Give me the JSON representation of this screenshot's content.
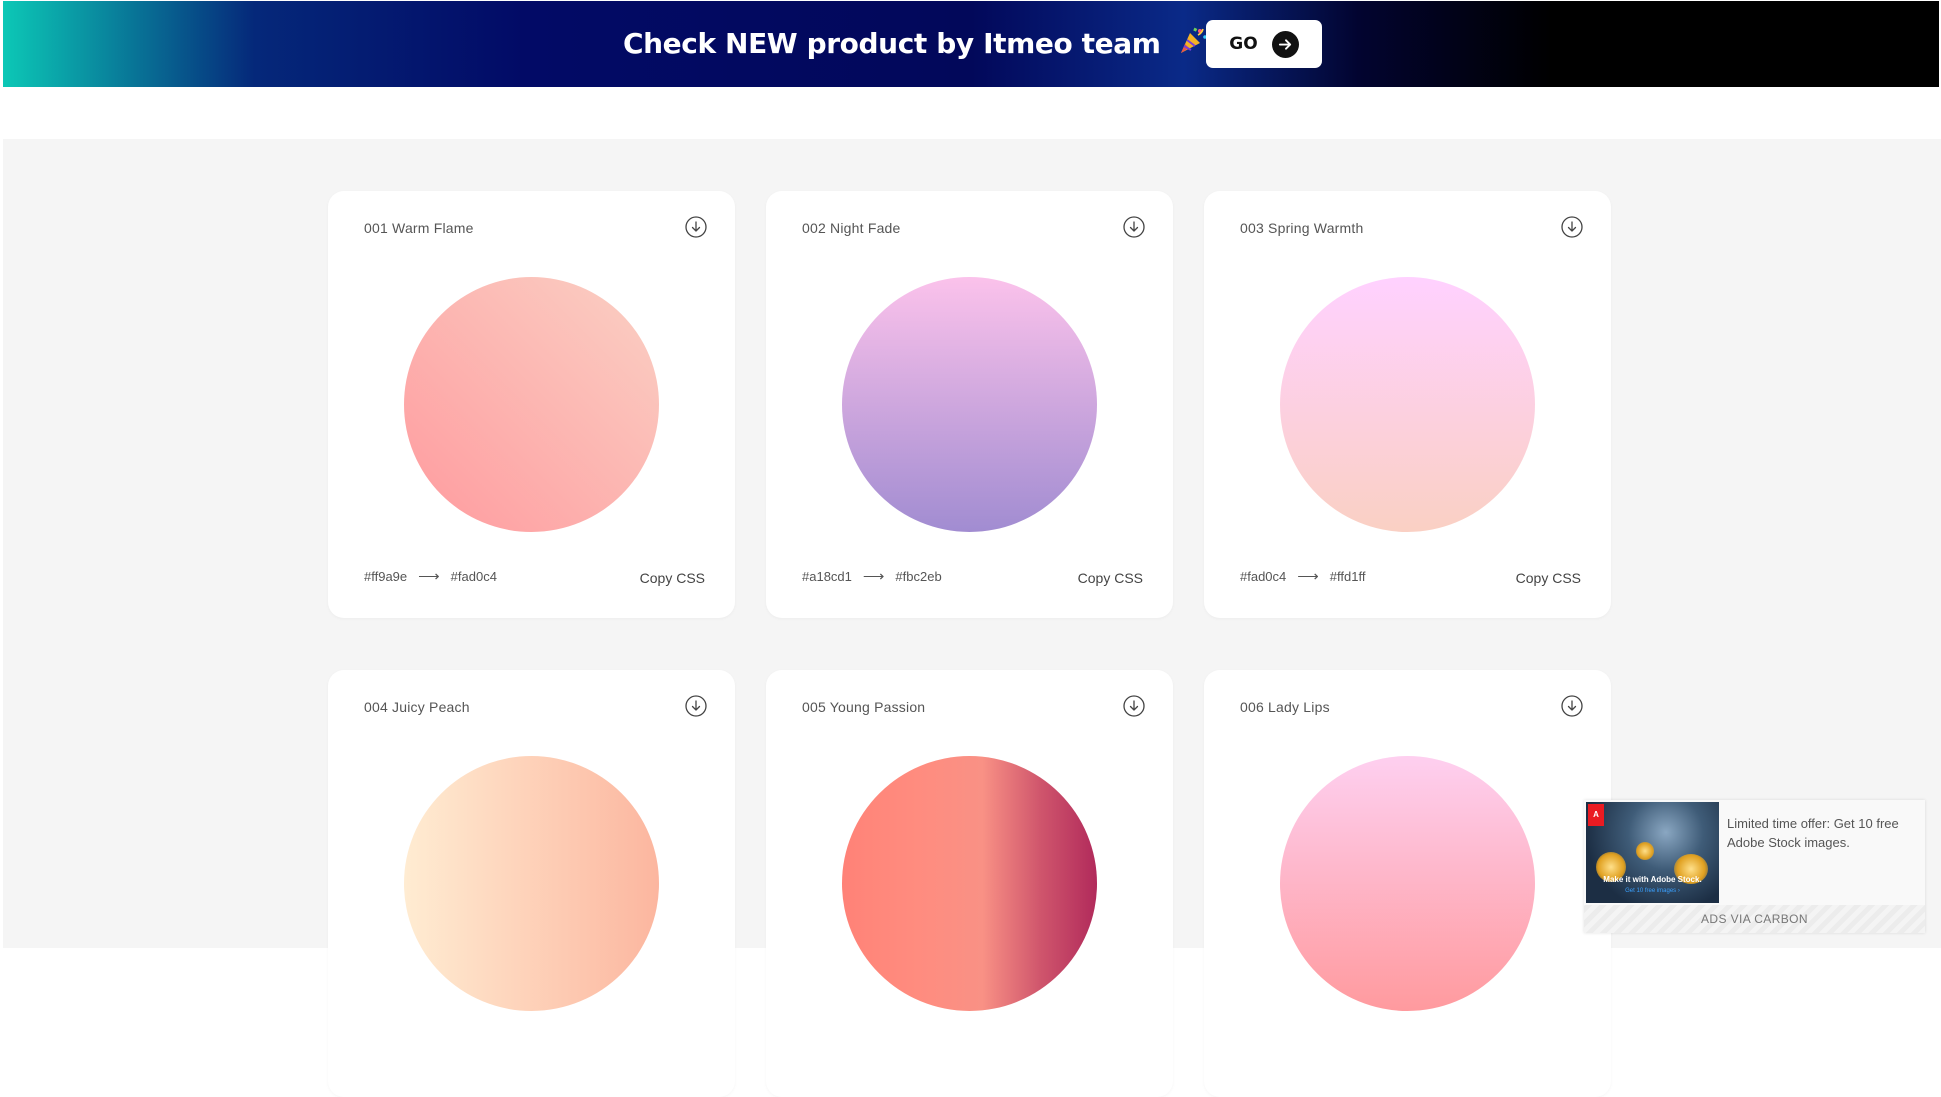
{
  "banner": {
    "text": "Check NEW product by Itmeo team",
    "icon": "party-popper-icon",
    "button_label": "GO",
    "button_icon": "arrow-right-circle-icon"
  },
  "gradients": [
    {
      "title": "001 Warm Flame",
      "from": "#ff9a9e",
      "to": "#fad0c4",
      "copy_label": "Copy CSS",
      "download_icon": "download-icon"
    },
    {
      "title": "002 Night Fade",
      "from": "#a18cd1",
      "to": "#fbc2eb",
      "copy_label": "Copy CSS",
      "download_icon": "download-icon"
    },
    {
      "title": "003 Spring Warmth",
      "from": "#fad0c4",
      "to": "#ffd1ff",
      "copy_label": "Copy CSS",
      "download_icon": "download-icon"
    },
    {
      "title": "004 Juicy Peach",
      "from": "#ffecd2",
      "to": "#fcb69f",
      "download_icon": "download-icon"
    },
    {
      "title": "005 Young Passion",
      "download_icon": "download-icon"
    },
    {
      "title": "006 Lady Lips",
      "download_icon": "download-icon"
    }
  ],
  "hex_arrow": "⟶",
  "ad": {
    "text": "Limited time offer: Get 10 free Adobe Stock images.",
    "image_caption": "Make it with Adobe Stock.",
    "image_subcaption": "Get 10 free images ›",
    "footer": "ADS VIA CARBON"
  }
}
